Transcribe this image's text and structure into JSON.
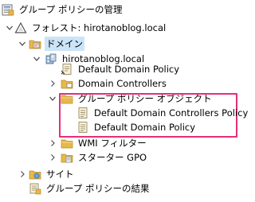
{
  "tree": {
    "root": "グループ ポリシーの管理",
    "forest": "フォレスト: hirotanoblog.local",
    "domains": "ドメイン",
    "domain": "hirotanoblog.local",
    "default_domain_policy_link": "Default Domain Policy",
    "domain_controllers": "Domain Controllers",
    "gpo_container": "グループ ポリシー オブジェクト",
    "gpo_items": [
      "Default Domain Controllers Policy",
      "Default Domain Policy"
    ],
    "wmi_filters": "WMI フィルター",
    "starter_gpos": "スターター GPO",
    "sites": "サイト",
    "gp_results": "グループ ポリシーの結果"
  },
  "colors": {
    "selection": "#cce4f7",
    "highlight_border": "#e52d78",
    "folder": "#e8b84a"
  },
  "icons": {
    "root": "gpm-console-icon",
    "forest": "forest-triangle-icon",
    "domains": "domains-folder-icon",
    "domain": "domain-icon",
    "gpo_link": "gpo-link-icon",
    "ou": "organizational-unit-icon",
    "folder": "folder-icon",
    "gpo": "gpo-document-icon",
    "sites": "sites-icon",
    "results": "results-icon"
  }
}
